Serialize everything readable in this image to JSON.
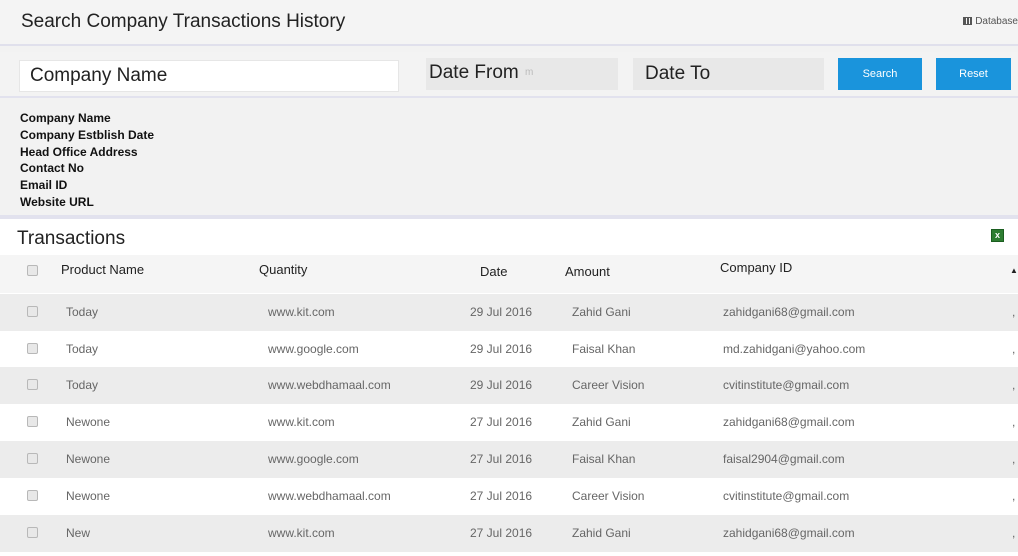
{
  "header": {
    "title": "Search Company Transactions History",
    "database_link": "Database"
  },
  "search": {
    "company_name": "Company Name",
    "date_from": "Date From",
    "date_from_ghost": "m",
    "date_to": "Date To",
    "search_label": "Search",
    "reset_label": "Reset"
  },
  "details": {
    "lines": [
      "Company Name",
      "Company Estblish Date",
      "Head Office Address",
      "Contact No",
      "Email ID",
      "Website URL"
    ]
  },
  "transactions": {
    "title": "Transactions",
    "columns": {
      "product": "Product Name",
      "quantity": "Quantity",
      "date": "Date",
      "amount": "Amount",
      "company_id": "Company ID"
    },
    "rows": [
      {
        "product": "Today",
        "quantity": "www.kit.com",
        "date": "29 Jul 2016",
        "amount": "Zahid Gani",
        "company_id": "zahidgani68@gmail.com",
        "extra": ","
      },
      {
        "product": "Today",
        "quantity": "www.google.com",
        "date": "29 Jul 2016",
        "amount": "Faisal Khan",
        "company_id": "md.zahidgani@yahoo.com",
        "extra": ","
      },
      {
        "product": "Today",
        "quantity": "www.webdhamaal.com",
        "date": "29 Jul 2016",
        "amount": "Career Vision",
        "company_id": "cvitinstitute@gmail.com",
        "extra": ","
      },
      {
        "product": "Newone",
        "quantity": "www.kit.com",
        "date": "27 Jul 2016",
        "amount": "Zahid Gani",
        "company_id": "zahidgani68@gmail.com",
        "extra": ","
      },
      {
        "product": "Newone",
        "quantity": "www.google.com",
        "date": "27 Jul 2016",
        "amount": "Faisal Khan",
        "company_id": "faisal2904@gmail.com",
        "extra": ","
      },
      {
        "product": "Newone",
        "quantity": "www.webdhamaal.com",
        "date": "27 Jul 2016",
        "amount": "Career Vision",
        "company_id": "cvitinstitute@gmail.com",
        "extra": ","
      },
      {
        "product": "New",
        "quantity": "www.kit.com",
        "date": "27 Jul 2016",
        "amount": "Zahid Gani",
        "company_id": "zahidgani68@gmail.com",
        "extra": ","
      }
    ]
  }
}
